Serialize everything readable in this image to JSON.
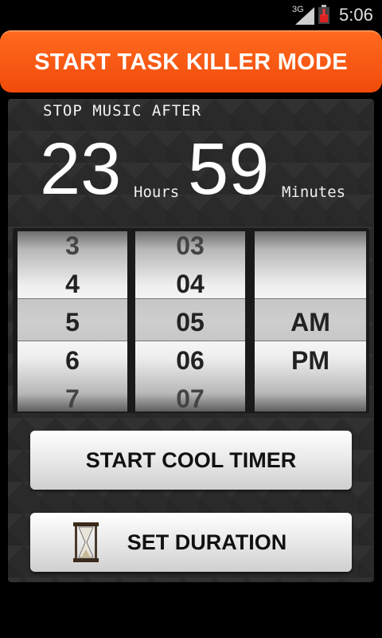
{
  "status_bar": {
    "network": "3G",
    "time": "5:06"
  },
  "top_button": {
    "label": "START TASK KILLER MODE"
  },
  "timer": {
    "title": "STOP MUSIC AFTER",
    "hours": "23",
    "hours_unit": "Hours",
    "minutes": "59",
    "minutes_unit": "Minutes"
  },
  "picker": {
    "hours": [
      "3",
      "4",
      "5",
      "6",
      "7"
    ],
    "minutes": [
      "03",
      "04",
      "05",
      "06",
      "07"
    ],
    "ampm": [
      "AM",
      "PM"
    ]
  },
  "buttons": {
    "start_cool_timer": "START COOL TIMER",
    "set_duration": "SET DURATION"
  },
  "colors": {
    "accent": "#f25a14",
    "panel": "#2a2a2a"
  }
}
